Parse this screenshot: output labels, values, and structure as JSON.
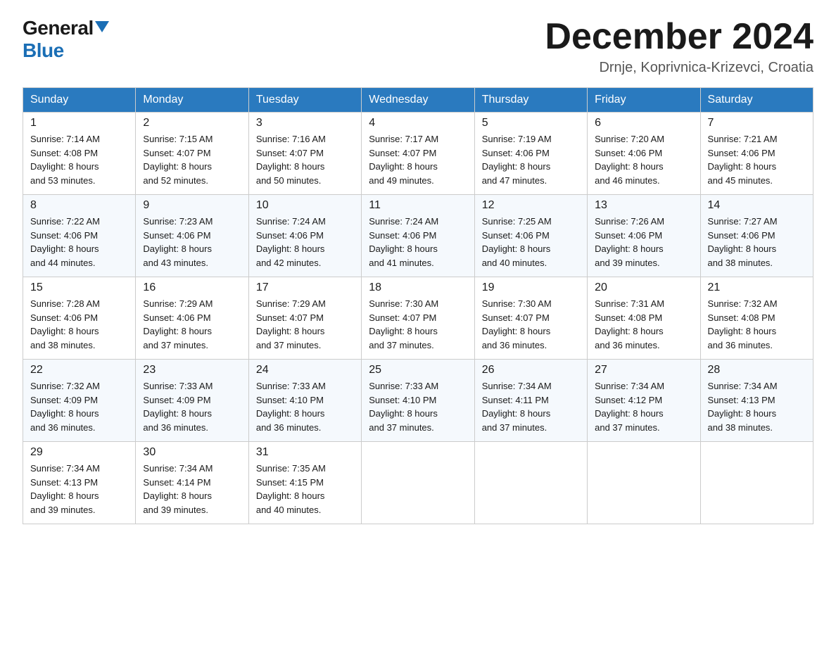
{
  "header": {
    "logo_general": "General",
    "logo_blue": "Blue",
    "month_title": "December 2024",
    "location": "Drnje, Koprivnica-Krizevci, Croatia"
  },
  "weekdays": [
    "Sunday",
    "Monday",
    "Tuesday",
    "Wednesday",
    "Thursday",
    "Friday",
    "Saturday"
  ],
  "weeks": [
    [
      {
        "day": "1",
        "sunrise": "7:14 AM",
        "sunset": "4:08 PM",
        "daylight": "8 hours and 53 minutes."
      },
      {
        "day": "2",
        "sunrise": "7:15 AM",
        "sunset": "4:07 PM",
        "daylight": "8 hours and 52 minutes."
      },
      {
        "day": "3",
        "sunrise": "7:16 AM",
        "sunset": "4:07 PM",
        "daylight": "8 hours and 50 minutes."
      },
      {
        "day": "4",
        "sunrise": "7:17 AM",
        "sunset": "4:07 PM",
        "daylight": "8 hours and 49 minutes."
      },
      {
        "day": "5",
        "sunrise": "7:19 AM",
        "sunset": "4:06 PM",
        "daylight": "8 hours and 47 minutes."
      },
      {
        "day": "6",
        "sunrise": "7:20 AM",
        "sunset": "4:06 PM",
        "daylight": "8 hours and 46 minutes."
      },
      {
        "day": "7",
        "sunrise": "7:21 AM",
        "sunset": "4:06 PM",
        "daylight": "8 hours and 45 minutes."
      }
    ],
    [
      {
        "day": "8",
        "sunrise": "7:22 AM",
        "sunset": "4:06 PM",
        "daylight": "8 hours and 44 minutes."
      },
      {
        "day": "9",
        "sunrise": "7:23 AM",
        "sunset": "4:06 PM",
        "daylight": "8 hours and 43 minutes."
      },
      {
        "day": "10",
        "sunrise": "7:24 AM",
        "sunset": "4:06 PM",
        "daylight": "8 hours and 42 minutes."
      },
      {
        "day": "11",
        "sunrise": "7:24 AM",
        "sunset": "4:06 PM",
        "daylight": "8 hours and 41 minutes."
      },
      {
        "day": "12",
        "sunrise": "7:25 AM",
        "sunset": "4:06 PM",
        "daylight": "8 hours and 40 minutes."
      },
      {
        "day": "13",
        "sunrise": "7:26 AM",
        "sunset": "4:06 PM",
        "daylight": "8 hours and 39 minutes."
      },
      {
        "day": "14",
        "sunrise": "7:27 AM",
        "sunset": "4:06 PM",
        "daylight": "8 hours and 38 minutes."
      }
    ],
    [
      {
        "day": "15",
        "sunrise": "7:28 AM",
        "sunset": "4:06 PM",
        "daylight": "8 hours and 38 minutes."
      },
      {
        "day": "16",
        "sunrise": "7:29 AM",
        "sunset": "4:06 PM",
        "daylight": "8 hours and 37 minutes."
      },
      {
        "day": "17",
        "sunrise": "7:29 AM",
        "sunset": "4:07 PM",
        "daylight": "8 hours and 37 minutes."
      },
      {
        "day": "18",
        "sunrise": "7:30 AM",
        "sunset": "4:07 PM",
        "daylight": "8 hours and 37 minutes."
      },
      {
        "day": "19",
        "sunrise": "7:30 AM",
        "sunset": "4:07 PM",
        "daylight": "8 hours and 36 minutes."
      },
      {
        "day": "20",
        "sunrise": "7:31 AM",
        "sunset": "4:08 PM",
        "daylight": "8 hours and 36 minutes."
      },
      {
        "day": "21",
        "sunrise": "7:32 AM",
        "sunset": "4:08 PM",
        "daylight": "8 hours and 36 minutes."
      }
    ],
    [
      {
        "day": "22",
        "sunrise": "7:32 AM",
        "sunset": "4:09 PM",
        "daylight": "8 hours and 36 minutes."
      },
      {
        "day": "23",
        "sunrise": "7:33 AM",
        "sunset": "4:09 PM",
        "daylight": "8 hours and 36 minutes."
      },
      {
        "day": "24",
        "sunrise": "7:33 AM",
        "sunset": "4:10 PM",
        "daylight": "8 hours and 36 minutes."
      },
      {
        "day": "25",
        "sunrise": "7:33 AM",
        "sunset": "4:10 PM",
        "daylight": "8 hours and 37 minutes."
      },
      {
        "day": "26",
        "sunrise": "7:34 AM",
        "sunset": "4:11 PM",
        "daylight": "8 hours and 37 minutes."
      },
      {
        "day": "27",
        "sunrise": "7:34 AM",
        "sunset": "4:12 PM",
        "daylight": "8 hours and 37 minutes."
      },
      {
        "day": "28",
        "sunrise": "7:34 AM",
        "sunset": "4:13 PM",
        "daylight": "8 hours and 38 minutes."
      }
    ],
    [
      {
        "day": "29",
        "sunrise": "7:34 AM",
        "sunset": "4:13 PM",
        "daylight": "8 hours and 39 minutes."
      },
      {
        "day": "30",
        "sunrise": "7:34 AM",
        "sunset": "4:14 PM",
        "daylight": "8 hours and 39 minutes."
      },
      {
        "day": "31",
        "sunrise": "7:35 AM",
        "sunset": "4:15 PM",
        "daylight": "8 hours and 40 minutes."
      },
      null,
      null,
      null,
      null
    ]
  ],
  "labels": {
    "sunrise": "Sunrise:",
    "sunset": "Sunset:",
    "daylight": "Daylight:"
  }
}
